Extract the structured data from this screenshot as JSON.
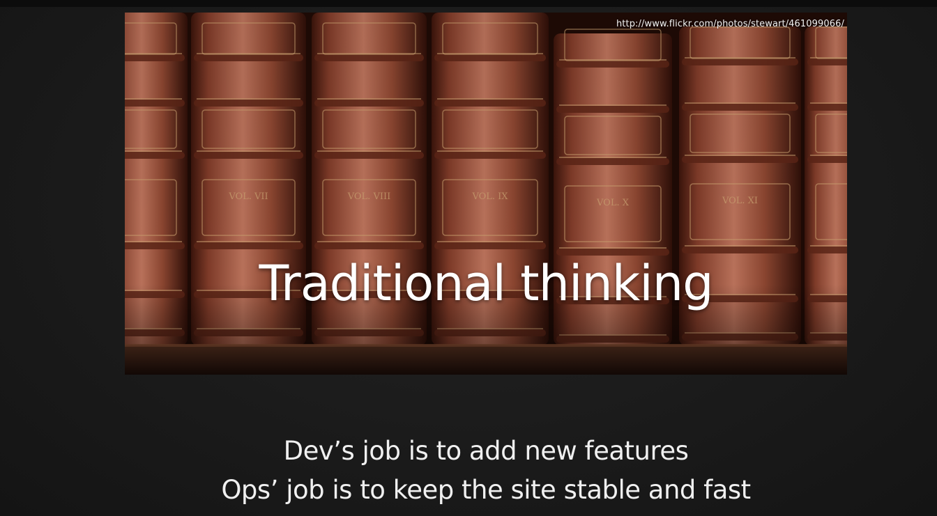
{
  "slide": {
    "photo_credit": "http://www.flickr.com/photos/stewart/461099066/",
    "title": "Traditional thinking",
    "lines": [
      "Dev’s job is to add new features",
      "Ops’ job is to keep the site stable and fast"
    ],
    "volume_labels": [
      "VOL. VII",
      "VOL. VIII",
      "VOL. IX",
      "VOL. X",
      "VOL. XI"
    ]
  },
  "colors": {
    "background": "#1b1b1b",
    "leather": "#7a3524",
    "gold": "#c9a070",
    "text": "#ffffff"
  }
}
